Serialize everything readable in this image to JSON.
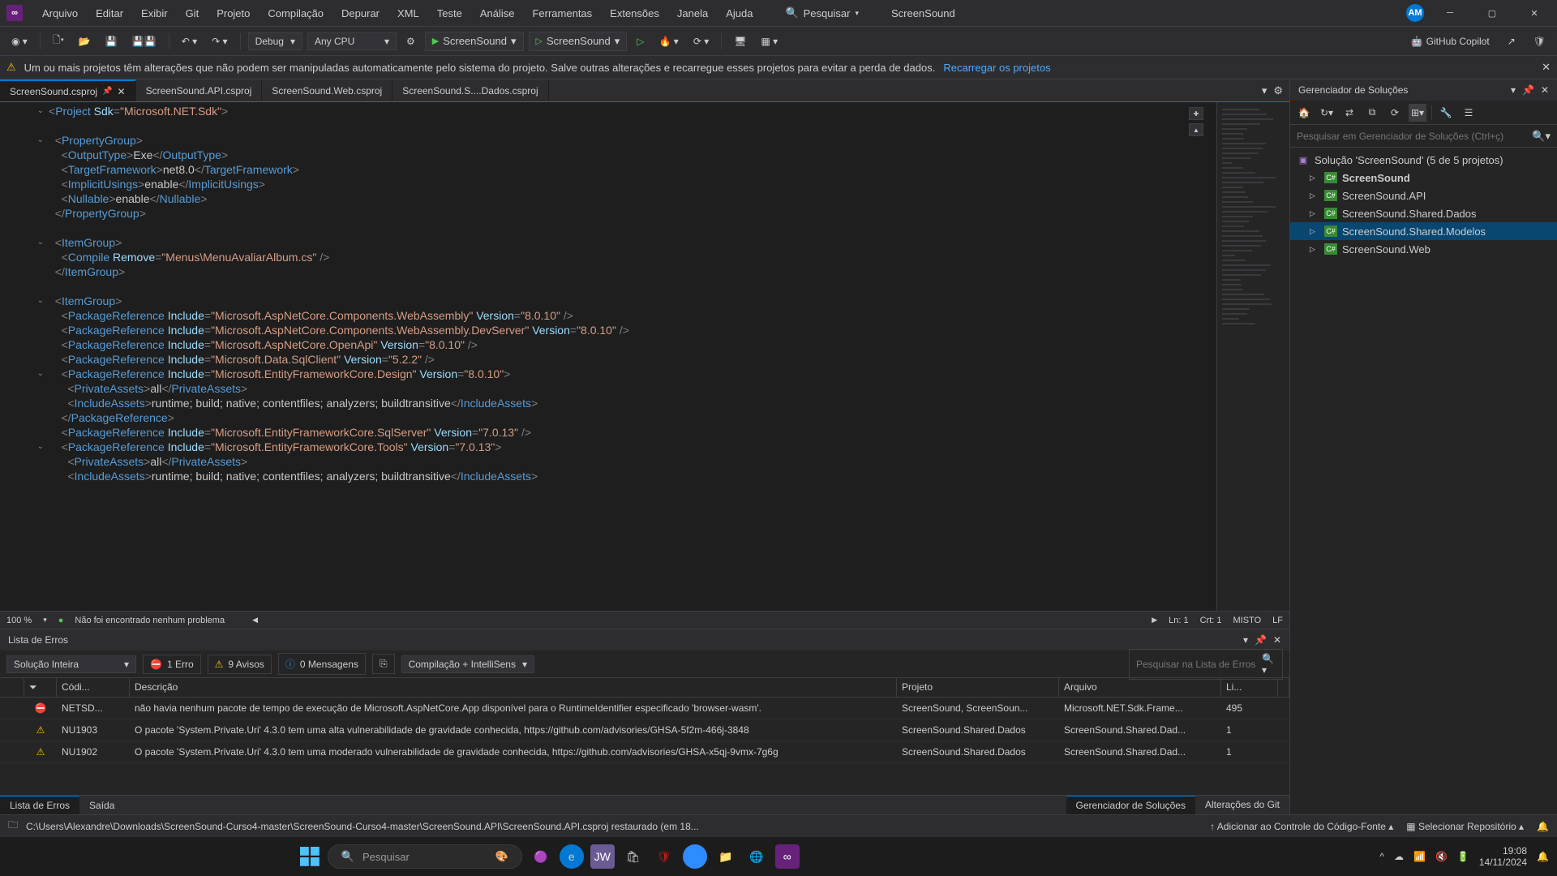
{
  "titlebar": {
    "menus": [
      "Arquivo",
      "Editar",
      "Exibir",
      "Git",
      "Projeto",
      "Compilação",
      "Depurar",
      "XML",
      "Teste",
      "Análise",
      "Ferramentas",
      "Extensões",
      "Janela",
      "Ajuda"
    ],
    "search_label": "Pesquisar",
    "app_title": "ScreenSound",
    "avatar": "AM"
  },
  "toolbar": {
    "config": "Debug",
    "platform": "Any CPU",
    "run1": "ScreenSound",
    "run2": "ScreenSound",
    "copilot": "GitHub Copilot"
  },
  "warnbar": {
    "message": "Um ou mais projetos têm alterações que não podem ser manipuladas automaticamente pelo sistema do projeto. Salve outras alterações e recarregue esses projetos para evitar a perda de dados.",
    "action": "Recarregar os projetos"
  },
  "tabs": [
    {
      "label": "ScreenSound.csproj",
      "active": true,
      "pinned": true,
      "close": true
    },
    {
      "label": "ScreenSound.API.csproj"
    },
    {
      "label": "ScreenSound.Web.csproj"
    },
    {
      "label": "ScreenSound.S....Dados.csproj"
    }
  ],
  "editor_status": {
    "zoom": "100 %",
    "issues": "Não foi encontrado nenhum problema",
    "ln": "Ln: 1",
    "ch": "Crt: 1",
    "enc": "MISTO",
    "eol": "LF"
  },
  "error_panel": {
    "title": "Lista de Erros",
    "scope": "Solução Inteira",
    "err_label": "1 Erro",
    "warn_label": "9 Avisos",
    "msg_label": "0 Mensagens",
    "build_mode": "Compilação + IntelliSens",
    "search_placeholder": "Pesquisar na Lista de Erros",
    "headers": {
      "code": "Códi...",
      "desc": "Descrição",
      "proj": "Projeto",
      "file": "Arquivo",
      "line": "Li..."
    },
    "rows": [
      {
        "type": "err",
        "code": "NETSD...",
        "desc": "não havia nenhum pacote de tempo de execução de Microsoft.AspNetCore.App disponível para o RuntimeIdentifier especificado 'browser-wasm'.",
        "proj": "ScreenSound, ScreenSoun...",
        "file": "Microsoft.NET.Sdk.Frame...",
        "line": "495"
      },
      {
        "type": "wrn",
        "code": "NU1903",
        "desc": "O pacote 'System.Private.Uri' 4.3.0 tem uma alta vulnerabilidade de gravidade conhecida, https://github.com/advisories/GHSA-5f2m-466j-3848",
        "proj": "ScreenSound.Shared.Dados",
        "file": "ScreenSound.Shared.Dad...",
        "line": "1"
      },
      {
        "type": "wrn",
        "code": "NU1902",
        "desc": "O pacote 'System.Private.Uri' 4.3.0 tem uma moderado vulnerabilidade de gravidade conhecida, https://github.com/advisories/GHSA-x5qj-9vmx-7g6g",
        "proj": "ScreenSound.Shared.Dados",
        "file": "ScreenSound.Shared.Dad...",
        "line": "1"
      }
    ]
  },
  "bottom_tabs": {
    "errors": "Lista de Erros",
    "output": "Saída",
    "sln": "Gerenciador de Soluções",
    "git": "Alterações do Git"
  },
  "sln": {
    "title": "Gerenciador de Soluções",
    "search_placeholder": "Pesquisar em Gerenciador de Soluções (Ctrl+ç)",
    "root": "Solução 'ScreenSound' (5 de 5 projetos)",
    "projects": [
      {
        "name": "ScreenSound",
        "bold": true
      },
      {
        "name": "ScreenSound.API"
      },
      {
        "name": "ScreenSound.Shared.Dados"
      },
      {
        "name": "ScreenSound.Shared.Modelos",
        "selected": true
      },
      {
        "name": "ScreenSound.Web"
      }
    ]
  },
  "statusbar": {
    "path": "C:\\Users\\Alexandre\\Downloads\\ScreenSound-Curso4-master\\ScreenSound-Curso4-master\\ScreenSound.API\\ScreenSound.API.csproj restaurado (em 18...",
    "source_control": "Adicionar ao Controle do Código-Fonte",
    "repo": "Selecionar Repositório"
  },
  "taskbar": {
    "search_placeholder": "Pesquisar",
    "time": "19:08",
    "date": "14/11/2024"
  },
  "code_lines": [
    {
      "html": "<span class='c-brk'>&lt;</span><span class='c-tag'>Project</span> <span class='c-attr'>Sdk</span><span class='c-brk'>=</span><span class='c-str'>\"Microsoft.NET.Sdk\"</span><span class='c-brk'>&gt;</span>"
    },
    {
      "html": ""
    },
    {
      "html": "  <span class='c-brk'>&lt;</span><span class='c-tag'>PropertyGroup</span><span class='c-brk'>&gt;</span>"
    },
    {
      "html": "    <span class='c-brk'>&lt;</span><span class='c-tag'>OutputType</span><span class='c-brk'>&gt;</span><span class='c-txt'>Exe</span><span class='c-brk'>&lt;/</span><span class='c-tag'>OutputType</span><span class='c-brk'>&gt;</span>"
    },
    {
      "html": "    <span class='c-brk'>&lt;</span><span class='c-tag'>TargetFramework</span><span class='c-brk'>&gt;</span><span class='c-txt'>net8.0</span><span class='c-brk'>&lt;/</span><span class='c-tag'>TargetFramework</span><span class='c-brk'>&gt;</span>"
    },
    {
      "html": "    <span class='c-brk'>&lt;</span><span class='c-tag'>ImplicitUsings</span><span class='c-brk'>&gt;</span><span class='c-txt'>enable</span><span class='c-brk'>&lt;/</span><span class='c-tag'>ImplicitUsings</span><span class='c-brk'>&gt;</span>"
    },
    {
      "html": "    <span class='c-brk'>&lt;</span><span class='c-tag'>Nullable</span><span class='c-brk'>&gt;</span><span class='c-txt'>enable</span><span class='c-brk'>&lt;/</span><span class='c-tag'>Nullable</span><span class='c-brk'>&gt;</span>"
    },
    {
      "html": "  <span class='c-brk'>&lt;/</span><span class='c-tag'>PropertyGroup</span><span class='c-brk'>&gt;</span>"
    },
    {
      "html": ""
    },
    {
      "html": "  <span class='c-brk'>&lt;</span><span class='c-tag'>ItemGroup</span><span class='c-brk'>&gt;</span>"
    },
    {
      "html": "    <span class='c-brk'>&lt;</span><span class='c-tag'>Compile</span> <span class='c-attr'>Remove</span><span class='c-brk'>=</span><span class='c-str'>\"Menus\\MenuAvaliarAlbum.cs\"</span> <span class='c-brk'>/&gt;</span>"
    },
    {
      "html": "  <span class='c-brk'>&lt;/</span><span class='c-tag'>ItemGroup</span><span class='c-brk'>&gt;</span>"
    },
    {
      "html": ""
    },
    {
      "html": "  <span class='c-brk'>&lt;</span><span class='c-tag'>ItemGroup</span><span class='c-brk'>&gt;</span>"
    },
    {
      "html": "    <span class='c-brk'>&lt;</span><span class='c-tag'>PackageReference</span> <span class='c-attr'>Include</span><span class='c-brk'>=</span><span class='c-str'>\"Microsoft.AspNetCore.Components.WebAssembly\"</span> <span class='c-attr'>Version</span><span class='c-brk'>=</span><span class='c-str'>\"8.0.10\"</span> <span class='c-brk'>/&gt;</span>"
    },
    {
      "html": "    <span class='c-brk'>&lt;</span><span class='c-tag'>PackageReference</span> <span class='c-attr'>Include</span><span class='c-brk'>=</span><span class='c-str'>\"Microsoft.AspNetCore.Components.WebAssembly.DevServer\"</span> <span class='c-attr'>Version</span><span class='c-brk'>=</span><span class='c-str'>\"8.0.10\"</span> <span class='c-brk'>/&gt;</span>"
    },
    {
      "html": "    <span class='c-brk'>&lt;</span><span class='c-tag'>PackageReference</span> <span class='c-attr'>Include</span><span class='c-brk'>=</span><span class='c-str'>\"Microsoft.AspNetCore.OpenApi\"</span> <span class='c-attr'>Version</span><span class='c-brk'>=</span><span class='c-str'>\"8.0.10\"</span> <span class='c-brk'>/&gt;</span>"
    },
    {
      "html": "    <span class='c-brk'>&lt;</span><span class='c-tag'>PackageReference</span> <span class='c-attr'>Include</span><span class='c-brk'>=</span><span class='c-str'>\"Microsoft.Data.SqlClient\"</span> <span class='c-attr'>Version</span><span class='c-brk'>=</span><span class='c-str'>\"5.2.2\"</span> <span class='c-brk'>/&gt;</span>"
    },
    {
      "html": "    <span class='c-brk'>&lt;</span><span class='c-tag'>PackageReference</span> <span class='c-attr'>Include</span><span class='c-brk'>=</span><span class='c-str'>\"Microsoft.EntityFrameworkCore.Design\"</span> <span class='c-attr'>Version</span><span class='c-brk'>=</span><span class='c-str'>\"8.0.10\"</span><span class='c-brk'>&gt;</span>"
    },
    {
      "html": "      <span class='c-brk'>&lt;</span><span class='c-tag'>PrivateAssets</span><span class='c-brk'>&gt;</span><span class='c-txt'>all</span><span class='c-brk'>&lt;/</span><span class='c-tag'>PrivateAssets</span><span class='c-brk'>&gt;</span>"
    },
    {
      "html": "      <span class='c-brk'>&lt;</span><span class='c-tag'>IncludeAssets</span><span class='c-brk'>&gt;</span><span class='c-txt'>runtime; build; native; contentfiles; analyzers; buildtransitive</span><span class='c-brk'>&lt;/</span><span class='c-tag'>IncludeAssets</span><span class='c-brk'>&gt;</span>"
    },
    {
      "html": "    <span class='c-brk'>&lt;/</span><span class='c-tag'>PackageReference</span><span class='c-brk'>&gt;</span>"
    },
    {
      "html": "    <span class='c-brk'>&lt;</span><span class='c-tag'>PackageReference</span> <span class='c-attr'>Include</span><span class='c-brk'>=</span><span class='c-str'>\"Microsoft.EntityFrameworkCore.SqlServer\"</span> <span class='c-attr'>Version</span><span class='c-brk'>=</span><span class='c-str'>\"7.0.13\"</span> <span class='c-brk'>/&gt;</span>"
    },
    {
      "html": "    <span class='c-brk'>&lt;</span><span class='c-tag'>PackageReference</span> <span class='c-attr'>Include</span><span class='c-brk'>=</span><span class='c-str'>\"Microsoft.EntityFrameworkCore.Tools\"</span> <span class='c-attr'>Version</span><span class='c-brk'>=</span><span class='c-str'>\"7.0.13\"</span><span class='c-brk'>&gt;</span>"
    },
    {
      "html": "      <span class='c-brk'>&lt;</span><span class='c-tag'>PrivateAssets</span><span class='c-brk'>&gt;</span><span class='c-txt'>all</span><span class='c-brk'>&lt;/</span><span class='c-tag'>PrivateAssets</span><span class='c-brk'>&gt;</span>"
    },
    {
      "html": "      <span class='c-brk'>&lt;</span><span class='c-tag'>IncludeAssets</span><span class='c-brk'>&gt;</span><span class='c-txt'>runtime; build; native; contentfiles; analyzers; buildtransitive</span><span class='c-brk'>&lt;/</span><span class='c-tag'>IncludeAssets</span><span class='c-brk'>&gt;</span>"
    }
  ]
}
